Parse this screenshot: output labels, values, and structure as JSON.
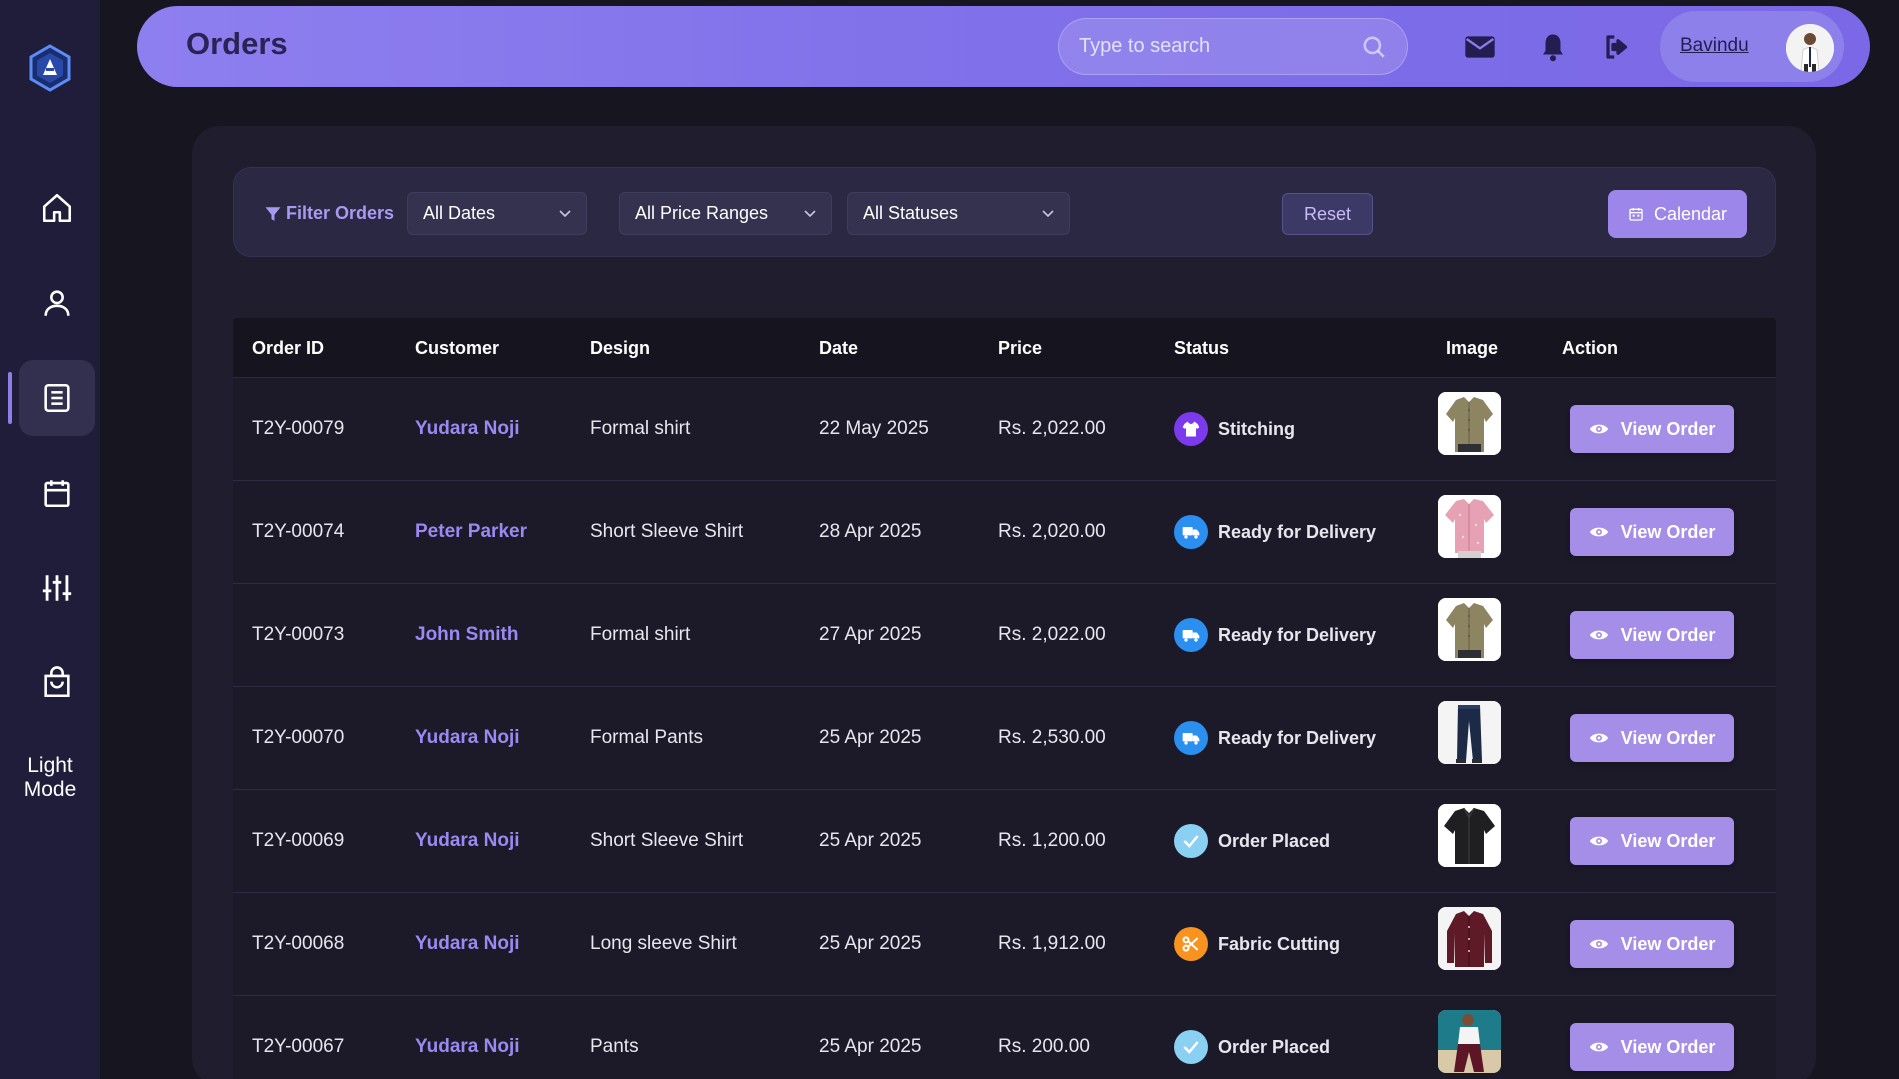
{
  "sidebar": {
    "items": [
      {
        "name": "home-icon",
        "active": false
      },
      {
        "name": "user-icon",
        "active": false
      },
      {
        "name": "orders-icon",
        "active": true
      },
      {
        "name": "calendar-icon",
        "active": false
      },
      {
        "name": "sliders-icon",
        "active": false
      },
      {
        "name": "shopping-bag-icon",
        "active": false
      }
    ],
    "mode_label_line1": "Light",
    "mode_label_line2": "Mode"
  },
  "header": {
    "title": "Orders",
    "search_placeholder": "Type to search",
    "user_name": "Bavindu"
  },
  "filters": {
    "label": "Filter Orders",
    "dates": "All Dates",
    "price_ranges": "All Price Ranges",
    "statuses": "All Statuses",
    "reset_label": "Reset",
    "calendar_label": "Calendar"
  },
  "table": {
    "columns": [
      "Order ID",
      "Customer",
      "Design",
      "Date",
      "Price",
      "Status",
      "Image",
      "Action"
    ],
    "rows": [
      {
        "id": "T2Y-00079",
        "customer": "Yudara Noji",
        "design": "Formal shirt",
        "date": "22 May 2025",
        "price": "Rs. 2,022.00",
        "status": "Stitching",
        "status_icon": "shirt-icon",
        "image": "khaki-shirt"
      },
      {
        "id": "T2Y-00074",
        "customer": "Peter Parker",
        "design": "Short Sleeve Shirt",
        "date": "28 Apr 2025",
        "price": "Rs. 2,020.00",
        "status": "Ready for Delivery",
        "status_icon": "delivery-truck-icon",
        "image": "pink-shirt"
      },
      {
        "id": "T2Y-00073",
        "customer": "John Smith",
        "design": "Formal shirt",
        "date": "27 Apr 2025",
        "price": "Rs. 2,022.00",
        "status": "Ready for Delivery",
        "status_icon": "delivery-truck-icon",
        "image": "khaki-shirt"
      },
      {
        "id": "T2Y-00070",
        "customer": "Yudara Noji",
        "design": "Formal Pants",
        "date": "25 Apr 2025",
        "price": "Rs. 2,530.00",
        "status": "Ready for Delivery",
        "status_icon": "delivery-truck-icon",
        "image": "navy-pants"
      },
      {
        "id": "T2Y-00069",
        "customer": "Yudara Noji",
        "design": "Short Sleeve Shirt",
        "date": "25 Apr 2025",
        "price": "Rs. 1,200.00",
        "status": "Order Placed",
        "status_icon": "check-icon",
        "image": "black-shirt"
      },
      {
        "id": "T2Y-00068",
        "customer": "Yudara Noji",
        "design": "Long sleeve Shirt",
        "date": "25 Apr 2025",
        "price": "Rs. 1,912.00",
        "status": "Fabric Cutting",
        "status_icon": "scissors-icon",
        "image": "maroon-shirt"
      },
      {
        "id": "T2Y-00067",
        "customer": "Yudara Noji",
        "design": "Pants",
        "date": "25 Apr 2025",
        "price": "Rs. 200.00",
        "status": "Order Placed",
        "status_icon": "check-icon",
        "image": "maroon-pants"
      }
    ],
    "action_label": "View Order"
  },
  "colors": {
    "accent": "#8f7ee8",
    "customer_link": "#9b88f0",
    "stitching": "#7c3aed",
    "ready_for_delivery": "#2b8ff0",
    "order_placed": "#8ad0f2",
    "fabric_cutting": "#f7931e"
  }
}
